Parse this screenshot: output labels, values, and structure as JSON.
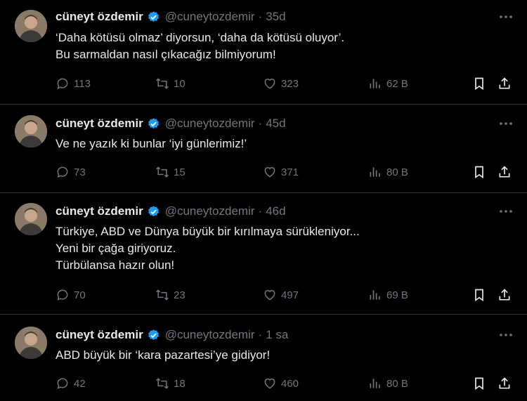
{
  "tweets": [
    {
      "name": "cüneyt özdemir",
      "handle": "@cuneytozdemir",
      "time": "35d",
      "lines": [
        "‘Daha kötüsü olmaz’ diyorsun, ‘daha da kötüsü oluyor’.",
        "Bu sarmaldan nasıl çıkacağız bilmiyorum!"
      ],
      "replies": "113",
      "retweets": "10",
      "likes": "323",
      "views": "62 B"
    },
    {
      "name": "cüneyt özdemir",
      "handle": "@cuneytozdemir",
      "time": "45d",
      "lines": [
        "Ve ne yazık ki bunlar ‘iyi günlerimiz!’"
      ],
      "replies": "73",
      "retweets": "15",
      "likes": "371",
      "views": "80 B"
    },
    {
      "name": "cüneyt özdemir",
      "handle": "@cuneytozdemir",
      "time": "46d",
      "lines": [
        "Türkiye, ABD ve Dünya büyük bir kırılmaya sürükleniyor...",
        "Yeni bir çağa giriyoruz.",
        "Türbülansa hazır olun!"
      ],
      "replies": "70",
      "retweets": "23",
      "likes": "497",
      "views": "69 B"
    },
    {
      "name": "cüneyt özdemir",
      "handle": "@cuneytozdemir",
      "time": "1 sa",
      "lines": [
        "ABD büyük bir ‘kara pazartesi’ye gidiyor!"
      ],
      "replies": "42",
      "retweets": "18",
      "likes": "460",
      "views": "80 B"
    }
  ],
  "colors": {
    "background": "#000000",
    "text": "#e7e9ea",
    "muted": "#71767b",
    "verified": "#1d9bf0",
    "divider": "#2f3336"
  }
}
